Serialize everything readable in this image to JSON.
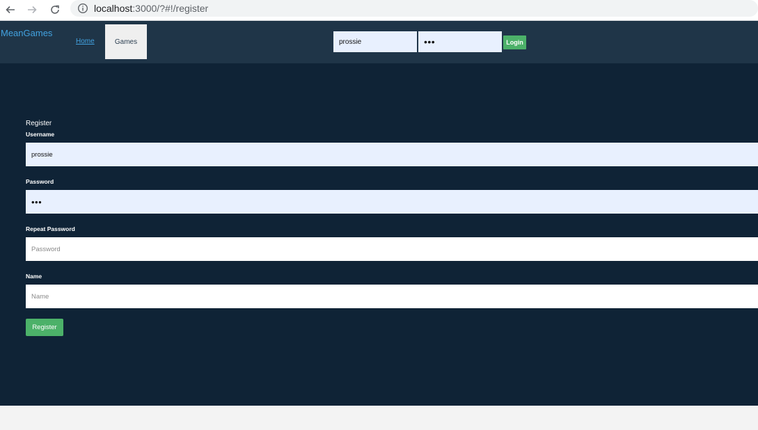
{
  "browser": {
    "url_host": "localhost",
    "url_rest": ":3000/?#!/register"
  },
  "navbar": {
    "brand": "MeanGames",
    "home_label": "Home",
    "games_label": "Games",
    "username_value": "prossie",
    "password_value": "•••",
    "login_label": "Login"
  },
  "form": {
    "title": "Register",
    "username_label": "Username",
    "username_value": "prossie",
    "password_label": "Password",
    "password_value": "•••",
    "repeat_password_label": "Repeat Password",
    "repeat_password_placeholder": "Password",
    "name_label": "Name",
    "name_placeholder": "Name",
    "register_label": "Register"
  },
  "colors": {
    "navbar_bg": "#1f3548",
    "main_bg": "#0f2336",
    "accent": "#42a2e0",
    "button_green": "#4cb169",
    "autofill_bg": "#e8f0fe"
  },
  "icons": [
    "back-arrow-icon",
    "forward-arrow-icon",
    "reload-icon",
    "info-icon"
  ]
}
